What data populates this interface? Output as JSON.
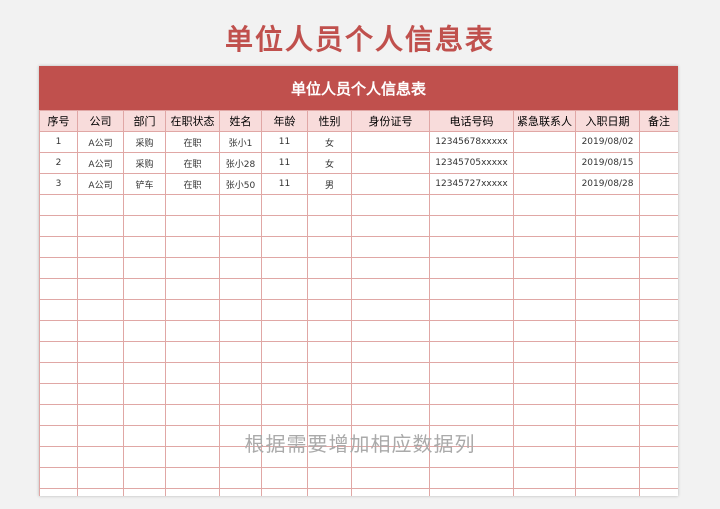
{
  "page_title": "单位人员个人信息表",
  "table_title": "单位人员个人信息表",
  "columns": [
    "序号",
    "公司",
    "部门",
    "在职状态",
    "姓名",
    "年龄",
    "性别",
    "身份证号",
    "电话号码",
    "紧急联系人",
    "入职日期",
    "备注"
  ],
  "rows": [
    [
      "1",
      "A公司",
      "采购",
      "在职",
      "张小1",
      "11",
      "女",
      "",
      "12345678xxxxx",
      "",
      "2019/08/02",
      ""
    ],
    [
      "2",
      "A公司",
      "采购",
      "在职",
      "张小28",
      "11",
      "女",
      "",
      "12345705xxxxx",
      "",
      "2019/08/15",
      ""
    ],
    [
      "3",
      "A公司",
      "铲车",
      "在职",
      "张小50",
      "11",
      "男",
      "",
      "12345727xxxxx",
      "",
      "2019/08/28",
      ""
    ]
  ],
  "empty_rows": 15,
  "watermark": "根据需要增加相应数据列",
  "colors": {
    "accent": "#c0504d",
    "header_bg": "#f8dcdb",
    "grid": "#e0a7a5"
  }
}
